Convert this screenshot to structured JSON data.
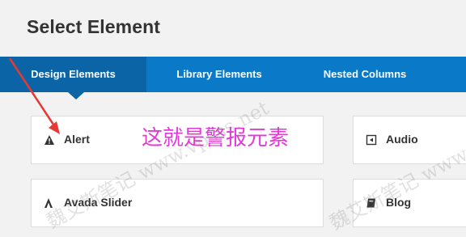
{
  "dialog": {
    "title": "Select Element"
  },
  "tabs": [
    {
      "label": "Design Elements",
      "active": true
    },
    {
      "label": "Library Elements",
      "active": false
    },
    {
      "label": "Nested Columns",
      "active": false
    }
  ],
  "elements": [
    {
      "label": "Alert",
      "icon": "alert-triangle-icon"
    },
    {
      "label": "Audio",
      "icon": "audio-icon"
    },
    {
      "label": "Avada Slider",
      "icon": "avada-icon"
    },
    {
      "label": "Blog",
      "icon": "book-icon"
    }
  ],
  "annotation": {
    "text": "这就是警报元素",
    "color": "#e23ad8"
  },
  "watermark": {
    "text": "魏艾斯笔记 www.vpsss.net"
  },
  "colors": {
    "tab_bar": "#0a79c7",
    "tab_active": "#0b64a6",
    "arrow": "#e53935"
  }
}
